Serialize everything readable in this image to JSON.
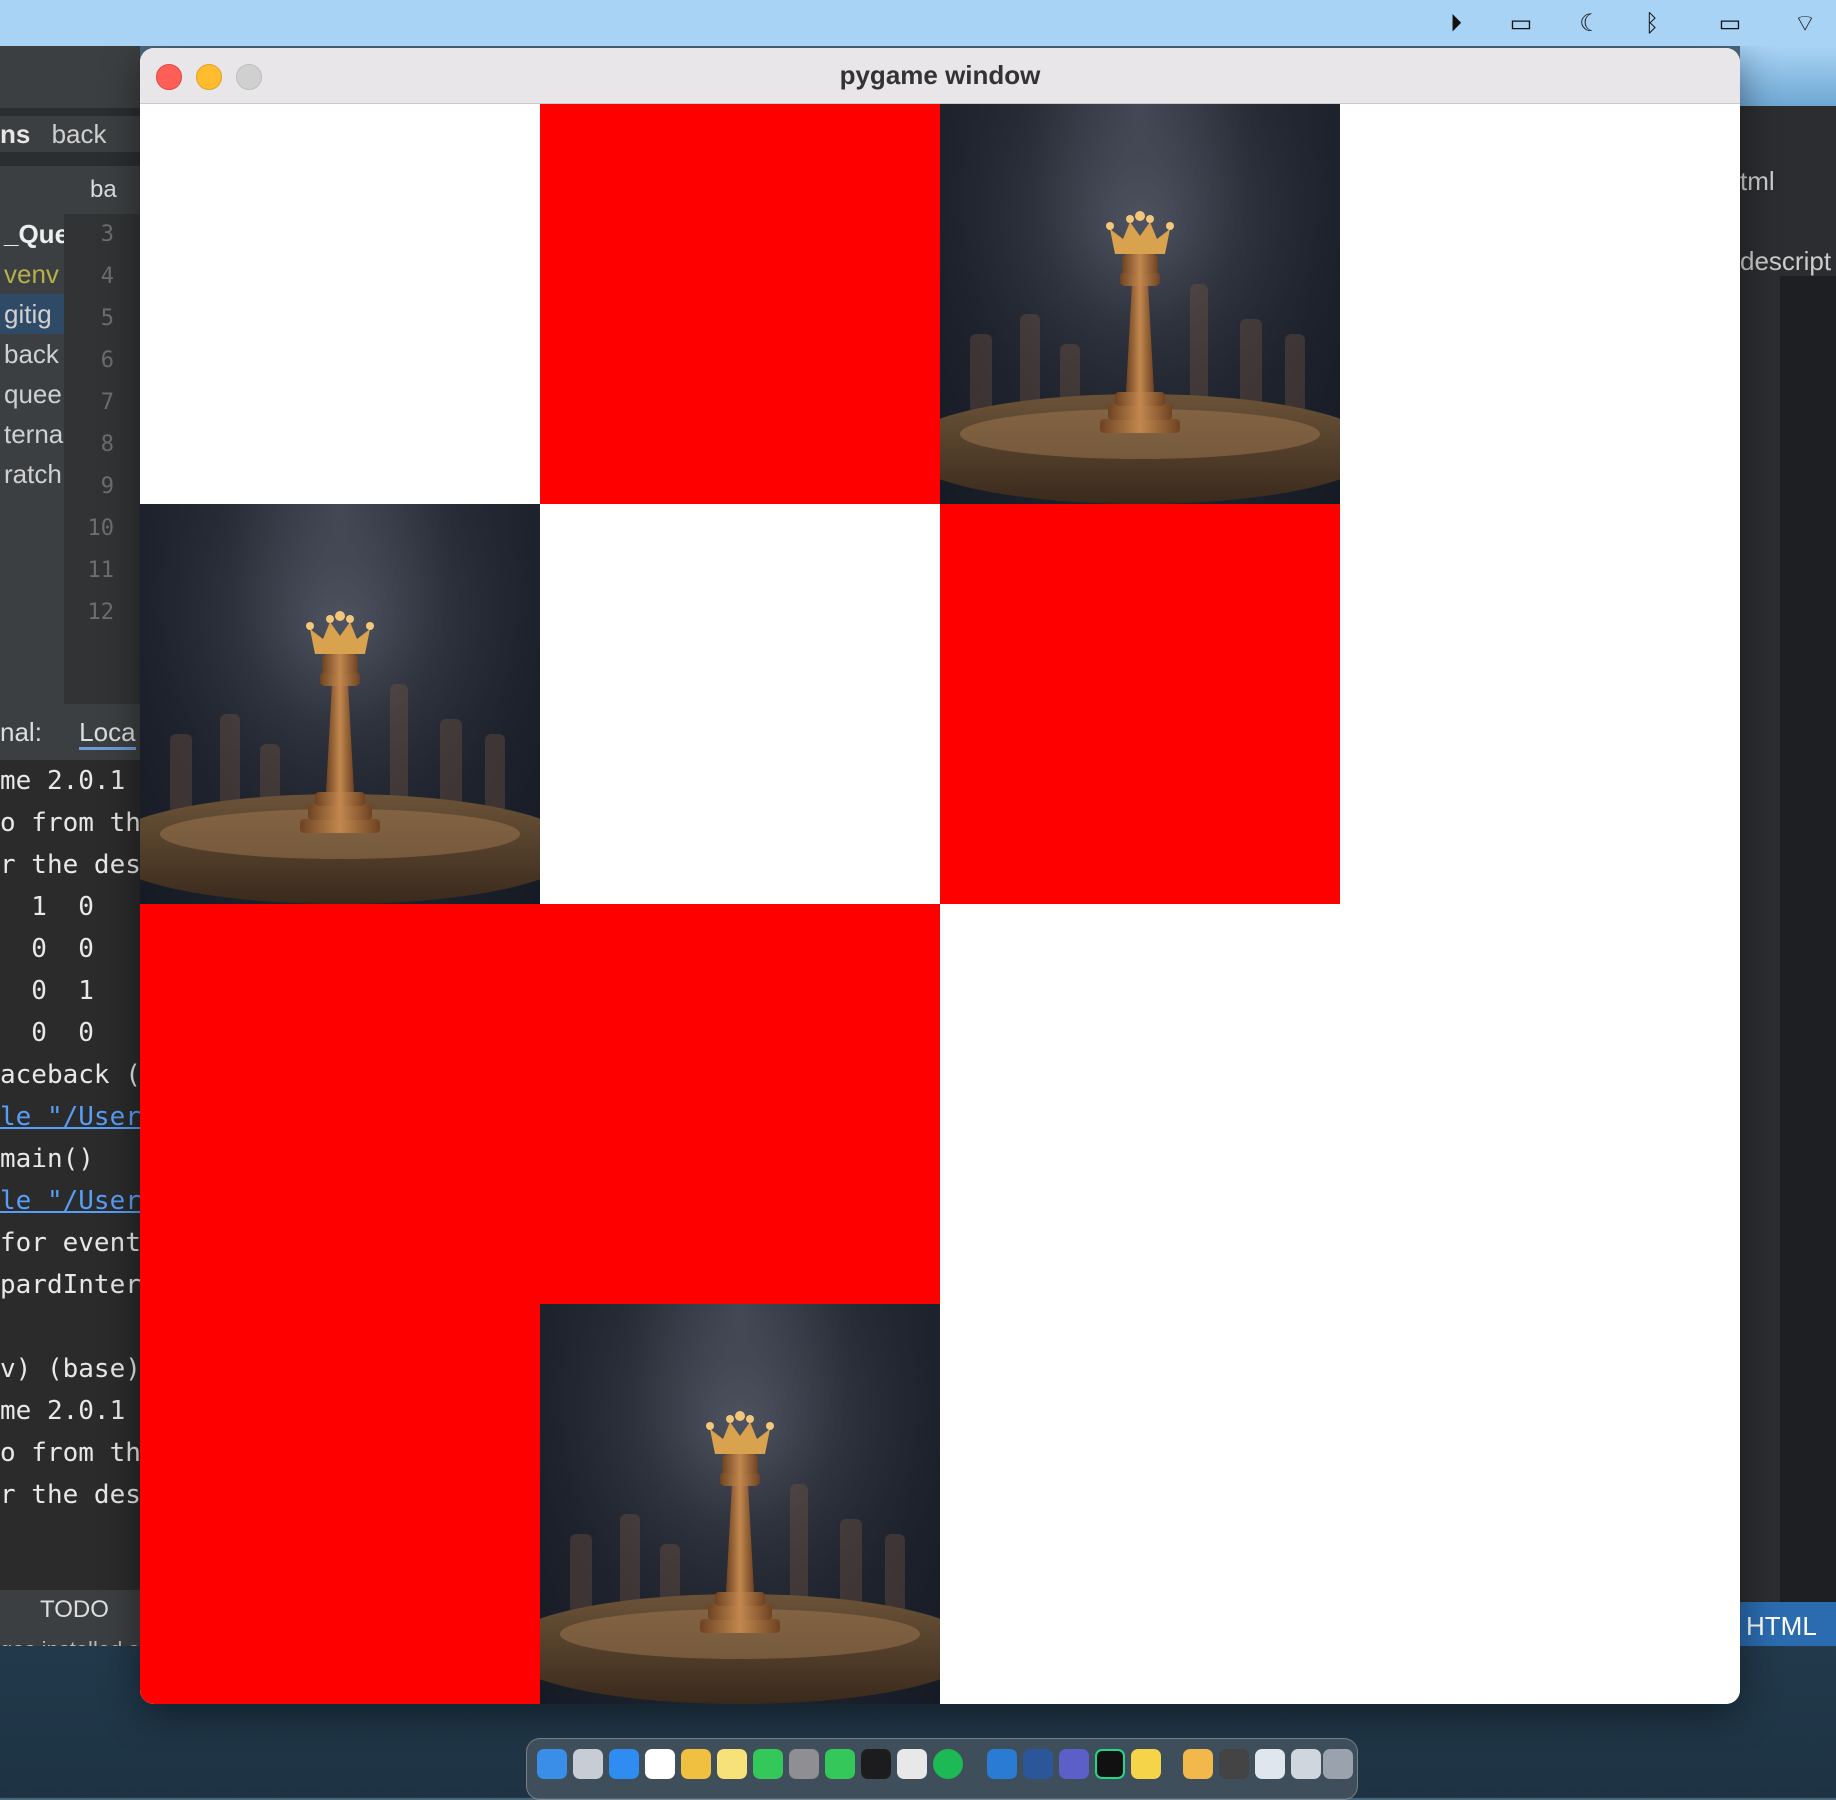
{
  "window": {
    "title": "pygame window"
  },
  "board": {
    "cells": [
      {
        "row": 0,
        "col": 0,
        "fill": "white"
      },
      {
        "row": 0,
        "col": 1,
        "fill": "red"
      },
      {
        "row": 0,
        "col": 2,
        "fill": "queen"
      },
      {
        "row": 1,
        "col": 0,
        "fill": "queen"
      },
      {
        "row": 1,
        "col": 1,
        "fill": "white"
      },
      {
        "row": 1,
        "col": 2,
        "fill": "red"
      },
      {
        "row": 2,
        "col": 0,
        "fill": "red"
      },
      {
        "row": 2,
        "col": 1,
        "fill": "red"
      },
      {
        "row": 3,
        "col": 0,
        "fill": "red"
      },
      {
        "row": 3,
        "col": 1,
        "fill": "queen"
      }
    ],
    "colors": {
      "red": "#ff0000",
      "white": "#ffffff"
    }
  },
  "ide_left": {
    "breadcrumb_project": "ns",
    "breadcrumb_file": "back",
    "tab_label": "ba",
    "tree": [
      "_Quee",
      "venv",
      "gitig",
      "back",
      "quee",
      "terna",
      "ratch"
    ],
    "line_numbers": [
      "3",
      "4",
      "5",
      "6",
      "7",
      "8",
      "9",
      "10",
      "11",
      "12"
    ],
    "terminal_label": "nal:",
    "terminal_tab": "Loca",
    "terminal_lines": [
      "me 2.0.1",
      "o from th",
      "r the des",
      "  1  0",
      "  0  0",
      "  0  1",
      "  0  0",
      "aceback (",
      "le \"/User",
      "main()",
      "le \"/User",
      "for event",
      "pardInter",
      "",
      "v) (base)",
      "me 2.0.1",
      "o from th",
      "r the des"
    ],
    "todo_label": "TODO",
    "status_text": "ges installed s"
  },
  "ide_right": {
    "tab_partial": "tml",
    "desc_partial": "descript",
    "language_label": "HTML"
  },
  "menubar_icons": [
    "play-icon",
    "screen-icon",
    "moon-icon",
    "bluetooth-icon",
    "battery-icon",
    "wifi-icon"
  ]
}
